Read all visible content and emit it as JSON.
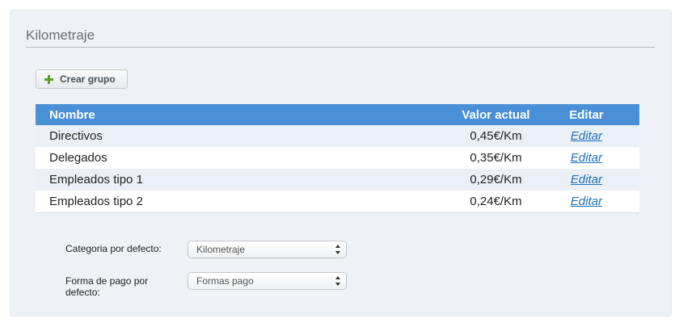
{
  "section": {
    "title": "Kilometraje"
  },
  "toolbar": {
    "create_label": "Crear grupo",
    "create_icon": "plus-icon"
  },
  "table": {
    "headers": {
      "name": "Nombre",
      "value": "Valor actual",
      "edit": "Editar"
    },
    "rows": [
      {
        "name": "Directivos",
        "value": "0,45€/Km",
        "edit": "Editar"
      },
      {
        "name": "Delegados",
        "value": "0,35€/Km",
        "edit": "Editar"
      },
      {
        "name": "Empleados tipo 1",
        "value": "0,29€/Km",
        "edit": "Editar"
      },
      {
        "name": "Empleados tipo 2",
        "value": "0,24€/Km",
        "edit": "Editar"
      }
    ]
  },
  "form": {
    "category_label": "Categoria por defecto:",
    "category_value": "Kilometraje",
    "payment_label_line1": "Forma de pago por",
    "payment_label_line2": "defecto:",
    "payment_value": "Formas pago"
  },
  "colors": {
    "header_bg": "#4a90d6",
    "row_alt_bg": "#eaf0f6",
    "link": "#1f6fb8",
    "plus_icon": "#5aa12c"
  }
}
